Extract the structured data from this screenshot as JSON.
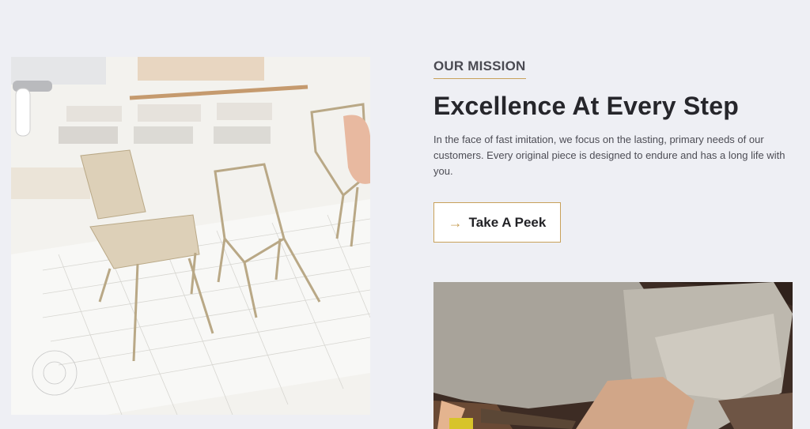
{
  "mission": {
    "eyebrow": "OUR MISSION",
    "title": "Excellence At Every Step",
    "description": "In the face of fast imitation, we focus on the lasting, primary needs of our customers. Every original piece is designed to endure and has a long life with you."
  },
  "cta": {
    "label": "Take A Peek",
    "icon": "arrow-right-icon",
    "icon_glyph": "→"
  },
  "colors": {
    "background": "#eeeff4",
    "accent": "#c8a15a",
    "heading": "#26262b",
    "body_text": "#4d4d55"
  }
}
